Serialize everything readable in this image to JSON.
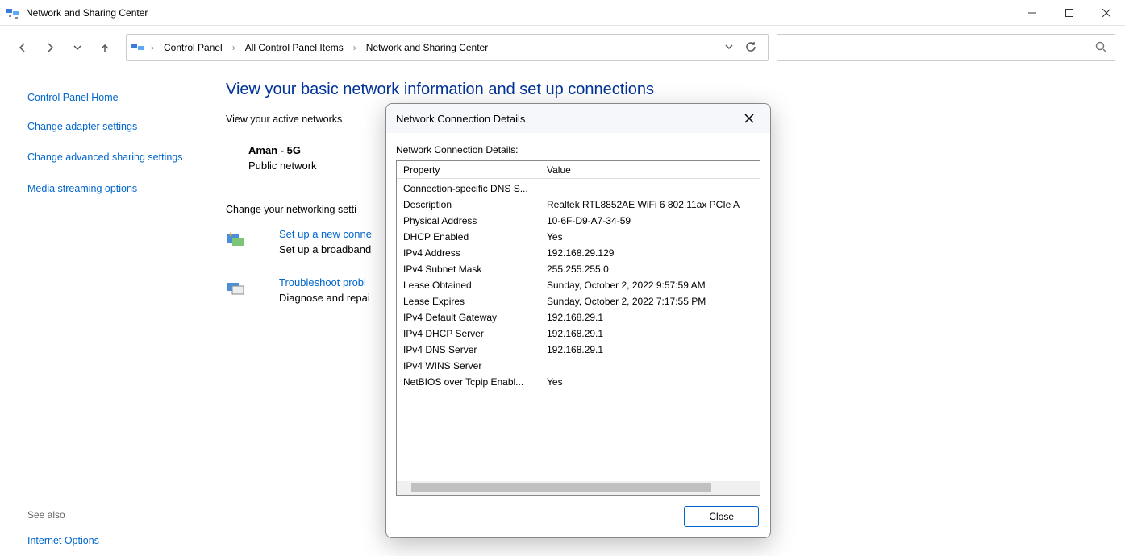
{
  "window": {
    "title": "Network and Sharing Center"
  },
  "breadcrumb": {
    "items": [
      "Control Panel",
      "All Control Panel Items",
      "Network and Sharing Center"
    ]
  },
  "sidebar": {
    "links": {
      "home": "Control Panel Home",
      "adapter": "Change adapter settings",
      "advanced": "Change advanced sharing settings",
      "media": "Media streaming options"
    },
    "see_also_heading": "See also",
    "see_also_links": {
      "inet": "Internet Options"
    }
  },
  "content": {
    "heading": "View your basic network information and set up connections",
    "active_label": "View your active networks",
    "network_name": "Aman - 5G",
    "network_type": "Public network",
    "change_settings_label": "Change your networking setti",
    "setup": {
      "link": "Set up a new conne",
      "desc": "Set up a broadband"
    },
    "troubleshoot": {
      "link": "Troubleshoot probl",
      "desc": "Diagnose and repai"
    }
  },
  "dialog": {
    "title": "Network Connection Details",
    "subtitle": "Network Connection Details:",
    "col_prop": "Property",
    "col_val": "Value",
    "close_label": "Close",
    "rows": [
      {
        "p": "Connection-specific DNS S...",
        "v": ""
      },
      {
        "p": "Description",
        "v": "Realtek RTL8852AE WiFi 6 802.11ax PCIe A"
      },
      {
        "p": "Physical Address",
        "v": "10-6F-D9-A7-34-59"
      },
      {
        "p": "DHCP Enabled",
        "v": "Yes"
      },
      {
        "p": "IPv4 Address",
        "v": "192.168.29.129"
      },
      {
        "p": "IPv4 Subnet Mask",
        "v": "255.255.255.0"
      },
      {
        "p": "Lease Obtained",
        "v": "Sunday, October 2, 2022 9:57:59 AM"
      },
      {
        "p": "Lease Expires",
        "v": "Sunday, October 2, 2022 7:17:55 PM"
      },
      {
        "p": "IPv4 Default Gateway",
        "v": "192.168.29.1"
      },
      {
        "p": "IPv4 DHCP Server",
        "v": "192.168.29.1"
      },
      {
        "p": "IPv4 DNS Server",
        "v": "192.168.29.1"
      },
      {
        "p": "IPv4 WINS Server",
        "v": ""
      },
      {
        "p": "NetBIOS over Tcpip Enabl...",
        "v": "Yes"
      }
    ]
  }
}
